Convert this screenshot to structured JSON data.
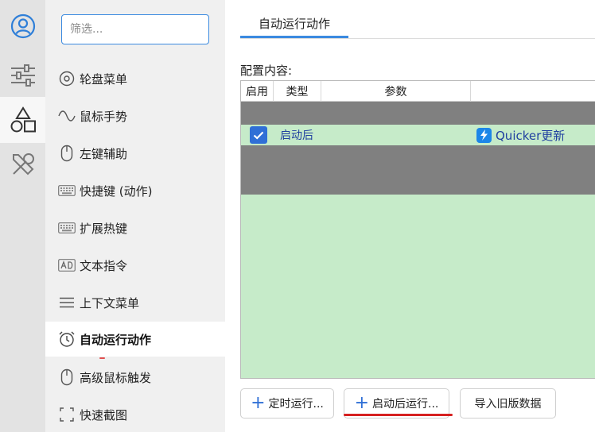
{
  "sidebar": {
    "filter_placeholder": "筛选...",
    "items": [
      {
        "label": "轮盘菜单",
        "icon": "circle-dot-icon"
      },
      {
        "label": "鼠标手势",
        "icon": "gesture-wave-icon"
      },
      {
        "label": "左键辅助",
        "icon": "mouse-icon"
      },
      {
        "label": "快捷键 (动作)",
        "icon": "keyboard-icon"
      },
      {
        "label": "扩展热键",
        "icon": "keyboard-icon"
      },
      {
        "label": "文本指令",
        "icon": "ad-text-icon"
      },
      {
        "label": "上下文菜单",
        "icon": "menu-lines-icon"
      },
      {
        "label": "自动运行动作",
        "icon": "alarm-clock-icon",
        "active": true
      },
      {
        "label": "高级鼠标触发",
        "icon": "mouse-icon"
      },
      {
        "label": "快速截图",
        "icon": "screenshot-corners-icon"
      }
    ]
  },
  "main": {
    "tab_label": "自动运行动作",
    "config_label": "配置内容:",
    "table": {
      "headers": [
        "启用",
        "类型",
        "参数"
      ],
      "rows": [
        {
          "enabled": true,
          "type": "启动后",
          "action": "Quicker更新"
        }
      ]
    },
    "buttons": {
      "timer_run": "定时运行...",
      "after_start_run": "启动后运行...",
      "import_old": "导入旧版数据"
    }
  },
  "colors": {
    "accent": "#2f6fd6",
    "row_green": "#c6ebc9",
    "row_gray": "#808080",
    "highlight_red": "#d62020"
  }
}
